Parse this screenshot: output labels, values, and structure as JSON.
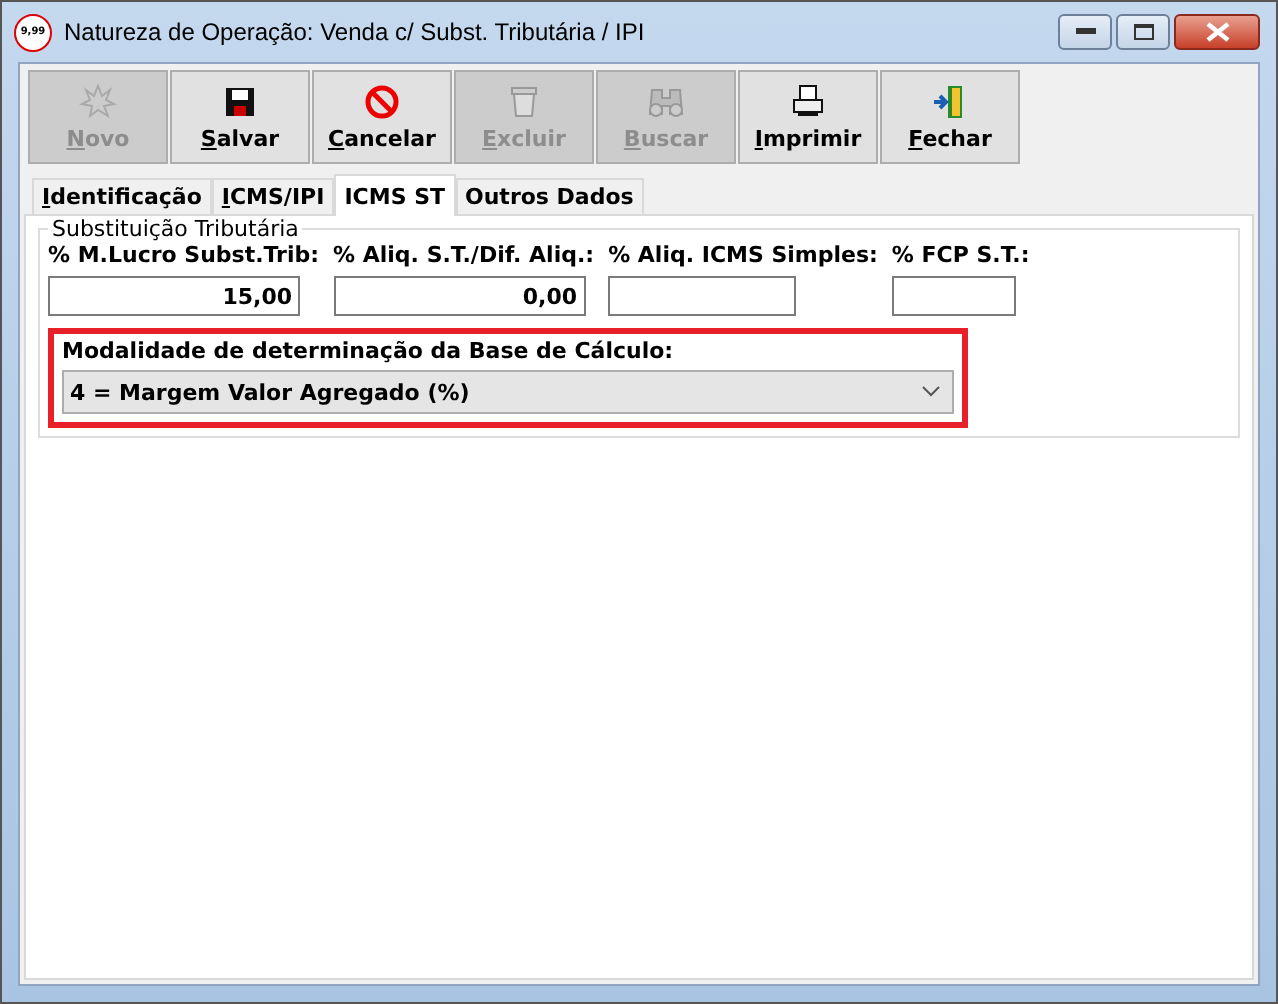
{
  "window": {
    "title": "Natureza de Operação:  Venda c/ Subst. Tributária / IPI",
    "app_icon_text": "9,99"
  },
  "toolbar": [
    {
      "label": "Novo",
      "kind": "burst",
      "disabled": true,
      "mnemonic": true
    },
    {
      "label": "Salvar",
      "kind": "floppy",
      "disabled": false,
      "mnemonic": true
    },
    {
      "label": "Cancelar",
      "kind": "forbidden",
      "disabled": false,
      "mnemonic": true
    },
    {
      "label": "Excluir",
      "kind": "trash",
      "disabled": true,
      "mnemonic": true
    },
    {
      "label": "Buscar",
      "kind": "binoculars",
      "disabled": true,
      "mnemonic": true
    },
    {
      "label": "Imprimir",
      "kind": "printer",
      "disabled": false,
      "mnemonic": true
    },
    {
      "label": "Fechar",
      "kind": "door",
      "disabled": false,
      "mnemonic": true
    }
  ],
  "tabs": [
    {
      "label": "Identificação",
      "selected": false,
      "mnemonic": true
    },
    {
      "label": "ICMS/IPI",
      "selected": false,
      "mnemonic": true
    },
    {
      "label": "ICMS ST",
      "selected": true,
      "mnemonic": false
    },
    {
      "label": "Outros Dados",
      "selected": false,
      "mnemonic": false
    }
  ],
  "group": {
    "title": "Substituição Tributária",
    "fields": [
      {
        "label": "% M.Lucro Subst.Trib:",
        "value": "15,00"
      },
      {
        "label": "% Aliq. S.T./Dif. Aliq.:",
        "value": "0,00"
      },
      {
        "label": "% Aliq. ICMS Simples:"
      },
      {
        "label": "% FCP S.T.:"
      }
    ]
  },
  "base_calculo": {
    "label": "Modalidade de determinação da Base de Cálculo:",
    "value": "4 = Margem Valor Agregado (%)",
    "highlighted": true
  }
}
